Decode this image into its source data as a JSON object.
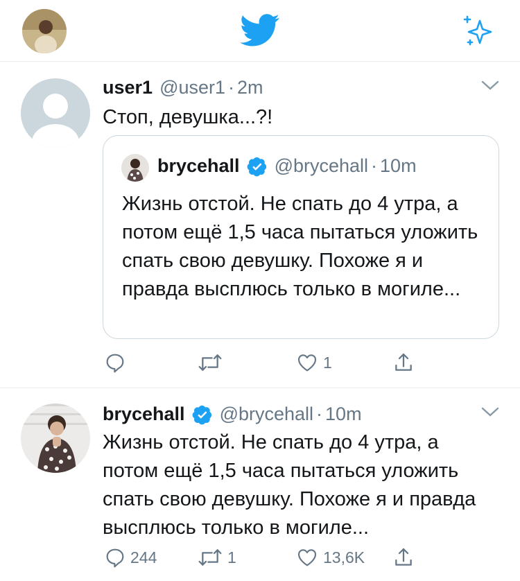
{
  "colors": {
    "accent": "#1da1f2",
    "muted": "#657786",
    "text": "#14171a",
    "border": "#e6ecf0"
  },
  "topbar": {
    "logo_icon": "twitter-bird-icon",
    "sparkle_icon": "sparkle-icon"
  },
  "tweet1": {
    "name": "user1",
    "handle": "@user1",
    "dot": "·",
    "time": "2m",
    "text": "Стоп, девушка...?!",
    "quote": {
      "name": "brycehall",
      "handle": "@brycehall",
      "dot": "·",
      "time": "10m",
      "text": "Жизнь отстой. Не спать до 4 утра, а потом ещё 1,5 часа пытаться уложить спать свою девушку. Похоже я и правда высплюсь только в могиле..."
    },
    "actions": {
      "reply_count": "",
      "retweet_count": "",
      "like_count": "1"
    }
  },
  "tweet2": {
    "name": "brycehall",
    "handle": "@brycehall",
    "dot": "·",
    "time": "10m",
    "text": "Жизнь отстой. Не спать до 4 утра, а потом ещё 1,5 часа пытаться уложить спать свою девушку. Похоже я и правда высплюсь только в могиле...",
    "actions": {
      "reply_count": "244",
      "retweet_count": "1",
      "like_count": "13,6K"
    }
  }
}
